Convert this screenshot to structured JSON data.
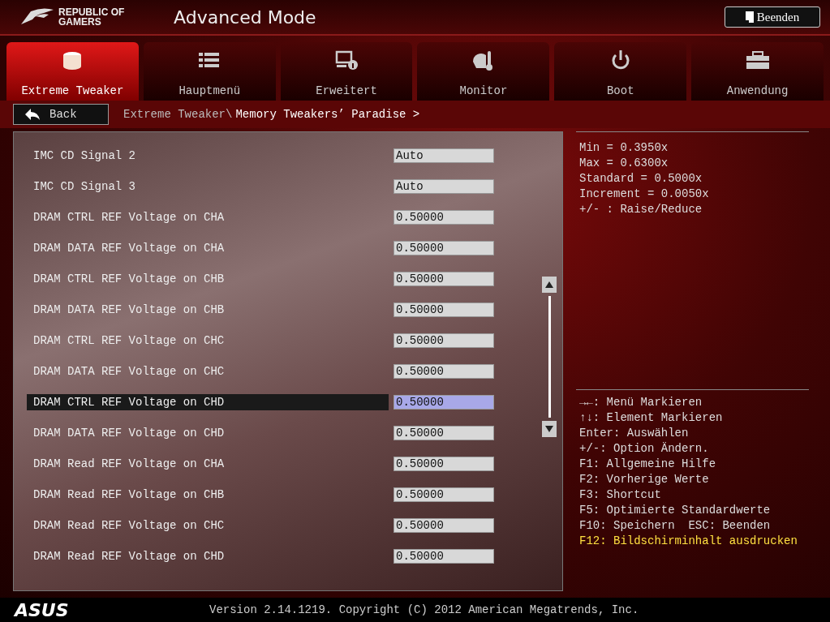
{
  "header": {
    "logo": "REPUBLIC OF GAMERS",
    "title": "Advanced Mode",
    "exit_button": "Beenden"
  },
  "tabs": [
    {
      "label": "Extreme Tweaker",
      "kind": "tweaker",
      "selected": true
    },
    {
      "label": "Hauptmenü",
      "kind": "list",
      "selected": false
    },
    {
      "label": "Erweitert",
      "kind": "info",
      "selected": false
    },
    {
      "label": "Monitor",
      "kind": "monitor",
      "selected": false
    },
    {
      "label": "Boot",
      "kind": "power",
      "selected": false
    },
    {
      "label": "Anwendung",
      "kind": "toolbox",
      "selected": false
    }
  ],
  "back_button": "Back",
  "breadcrumb": {
    "parent": "Extreme Tweaker\\",
    "current": "Memory Tweakers’ Paradise >"
  },
  "settings": [
    {
      "name": "IMC CD Signal 2",
      "value": "Auto",
      "selected": false
    },
    {
      "name": "IMC CD Signal 3",
      "value": "Auto",
      "selected": false
    },
    {
      "name": "DRAM CTRL REF Voltage on CHA",
      "value": "0.50000",
      "selected": false
    },
    {
      "name": "DRAM DATA REF Voltage on CHA",
      "value": "0.50000",
      "selected": false
    },
    {
      "name": "DRAM CTRL REF Voltage on CHB",
      "value": "0.50000",
      "selected": false
    },
    {
      "name": "DRAM DATA REF Voltage on CHB",
      "value": "0.50000",
      "selected": false
    },
    {
      "name": "DRAM CTRL REF Voltage on CHC",
      "value": "0.50000",
      "selected": false
    },
    {
      "name": "DRAM DATA REF Voltage on CHC",
      "value": "0.50000",
      "selected": false
    },
    {
      "name": "DRAM CTRL REF Voltage on CHD",
      "value": "0.50000",
      "selected": true
    },
    {
      "name": "DRAM DATA REF Voltage on CHD",
      "value": "0.50000",
      "selected": false
    },
    {
      "name": "DRAM Read REF Voltage on CHA",
      "value": "0.50000",
      "selected": false
    },
    {
      "name": "DRAM Read REF Voltage on CHB",
      "value": "0.50000",
      "selected": false
    },
    {
      "name": "DRAM Read REF Voltage on CHC",
      "value": "0.50000",
      "selected": false
    },
    {
      "name": "DRAM Read REF Voltage on CHD",
      "value": "0.50000",
      "selected": false
    }
  ],
  "info": [
    "Min = 0.3950x",
    "Max = 0.6300x",
    "Standard = 0.5000x",
    "Increment = 0.0050x",
    "+/- : Raise/Reduce"
  ],
  "key_help": [
    {
      "text": "→←: Menü Markieren",
      "highlight": false
    },
    {
      "text": "↑↓: Element Markieren",
      "highlight": false
    },
    {
      "text": "Enter: Auswählen",
      "highlight": false
    },
    {
      "text": "+/-: Option Ändern.",
      "highlight": false
    },
    {
      "text": "F1: Allgemeine Hilfe",
      "highlight": false
    },
    {
      "text": "F2: Vorherige Werte",
      "highlight": false
    },
    {
      "text": "F3: Shortcut",
      "highlight": false
    },
    {
      "text": "F5: Optimierte Standardwerte",
      "highlight": false
    },
    {
      "text": "F10: Speichern  ESC: Beenden",
      "highlight": false
    },
    {
      "text": "F12: Bildschirminhalt ausdrucken",
      "highlight": true
    }
  ],
  "footer": {
    "brand": "ASUS",
    "version": "Version 2.14.1219. Copyright (C) 2012 American Megatrends, Inc."
  }
}
